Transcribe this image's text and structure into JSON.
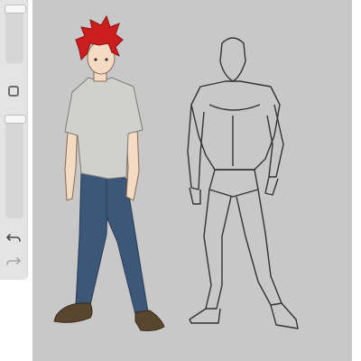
{
  "app": {
    "canvas_color": "#c8c8c8",
    "sidebar": {
      "controls": [
        {
          "name": "brush-size-slider",
          "value": 0.0
        },
        {
          "name": "modify-button",
          "icon": "square-icon"
        },
        {
          "name": "opacity-slider",
          "value": 0.0
        },
        {
          "name": "undo-button",
          "icon": "undo-icon"
        },
        {
          "name": "redo-button",
          "icon": "redo-icon",
          "enabled": false
        }
      ]
    },
    "artwork": {
      "figure_left": {
        "hair_color": "#cc1e1e",
        "shirt_color": "#d0d0cd",
        "jeans_color": "#3c5878",
        "shoe_color": "#5a4630"
      },
      "figure_right": {
        "line_color": "#333333"
      }
    }
  }
}
